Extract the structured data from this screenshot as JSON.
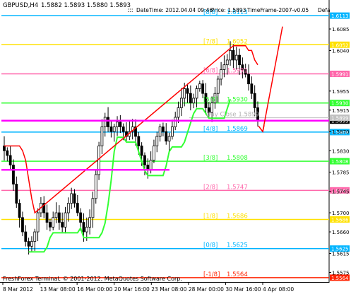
{
  "header": {
    "symbol": "GBPUSD,H4",
    "ohlc": "1.5882 1.5893 1.5880 1.5893",
    "datetime": "DateTime: 2012.04.04 09:46",
    "price": "Price: 1.5893",
    "timeframe": "TimeFrame-2007-v0.05",
    "truncated": "Defa"
  },
  "footer": {
    "copyright": "FreshForex Terminal, © 2001-2012, MetaQuotes Software Corp."
  },
  "murrey_lines": [
    {
      "label": "[8/8]",
      "value": "1.6113",
      "color": "#00b4ff"
    },
    {
      "label": "[7/8]",
      "value": "1.6052",
      "color": "#ffe100"
    },
    {
      "label": "[6/8]",
      "value": "1.5991",
      "color": "#ff66aa"
    },
    {
      "label": "[5/8]",
      "value": "1.5930",
      "color": "#33ff33"
    },
    {
      "label": "[4/8]",
      "value": "1.5869",
      "color": "#00b4ff"
    },
    {
      "label": "[3/8]",
      "value": "1.5808",
      "color": "#33ff33"
    },
    {
      "label": "[2/8]",
      "value": "1.5747",
      "color": "#ff66aa"
    },
    {
      "label": "[1/8]",
      "value": "1.5686",
      "color": "#ffe100"
    },
    {
      "label": "[0/8]",
      "value": "1.5625",
      "color": "#00b4ff"
    },
    {
      "label": "[-1/8]",
      "value": "1.5564",
      "color": "#ff2200"
    }
  ],
  "price_axis_ticks": [
    "1.6085",
    "1.6040",
    "1.5955",
    "1.5915",
    "1.5870",
    "1.5830",
    "1.5785",
    "1.5745",
    "1.5700",
    "1.5660",
    "1.5615",
    "1.5575"
  ],
  "current_price": "1.5893",
  "extra_tag": "1.5899",
  "day_close_label": "Day Close 1.5899",
  "time_axis": [
    "8 Mar 2012",
    "13 Mar 08:00",
    "16 Mar 00:00",
    "20 Mar 16:00",
    "23 Mar 08:00",
    "28 Mar 00:00",
    "30 Mar 16:00",
    "4 Apr 08:00"
  ],
  "colors": {
    "candle": "#000000",
    "green_trail": "#33ff33",
    "red_trail": "#ff0000",
    "current_price_line": "#ff00ff",
    "day_close_line": "#c0c0c0"
  },
  "chart_data": {
    "type": "candlestick",
    "symbol": "GBPUSD",
    "timeframe": "H4",
    "ylim": [
      1.5555,
      1.6125
    ],
    "last": {
      "open": 1.5882,
      "high": 1.5893,
      "low": 1.588,
      "close": 1.5893
    },
    "closes": [
      1.583,
      1.582,
      1.58,
      1.576,
      1.572,
      1.569,
      1.566,
      1.564,
      1.563,
      1.564,
      1.566,
      1.57,
      1.572,
      1.57,
      1.568,
      1.567,
      1.569,
      1.57,
      1.568,
      1.567,
      1.57,
      1.572,
      1.574,
      1.572,
      1.57,
      1.568,
      1.566,
      1.567,
      1.569,
      1.573,
      1.578,
      1.584,
      1.588,
      1.59,
      1.588,
      1.587,
      1.588,
      1.589,
      1.588,
      1.587,
      1.586,
      1.587,
      1.588,
      1.586,
      1.584,
      1.582,
      1.58,
      1.579,
      1.581,
      1.584,
      1.586,
      1.588,
      1.587,
      1.585,
      1.586,
      1.588,
      1.59,
      1.592,
      1.594,
      1.596,
      1.595,
      1.593,
      1.594,
      1.596,
      1.597,
      1.595,
      1.592,
      1.591,
      1.593,
      1.595,
      1.598,
      1.6,
      1.601,
      1.602,
      1.604,
      1.602,
      1.603,
      1.601,
      1.6,
      1.599,
      1.597,
      1.595,
      1.592,
      1.5893
    ],
    "forecast_arrow": {
      "from": 1.587,
      "to": 1.609
    }
  }
}
